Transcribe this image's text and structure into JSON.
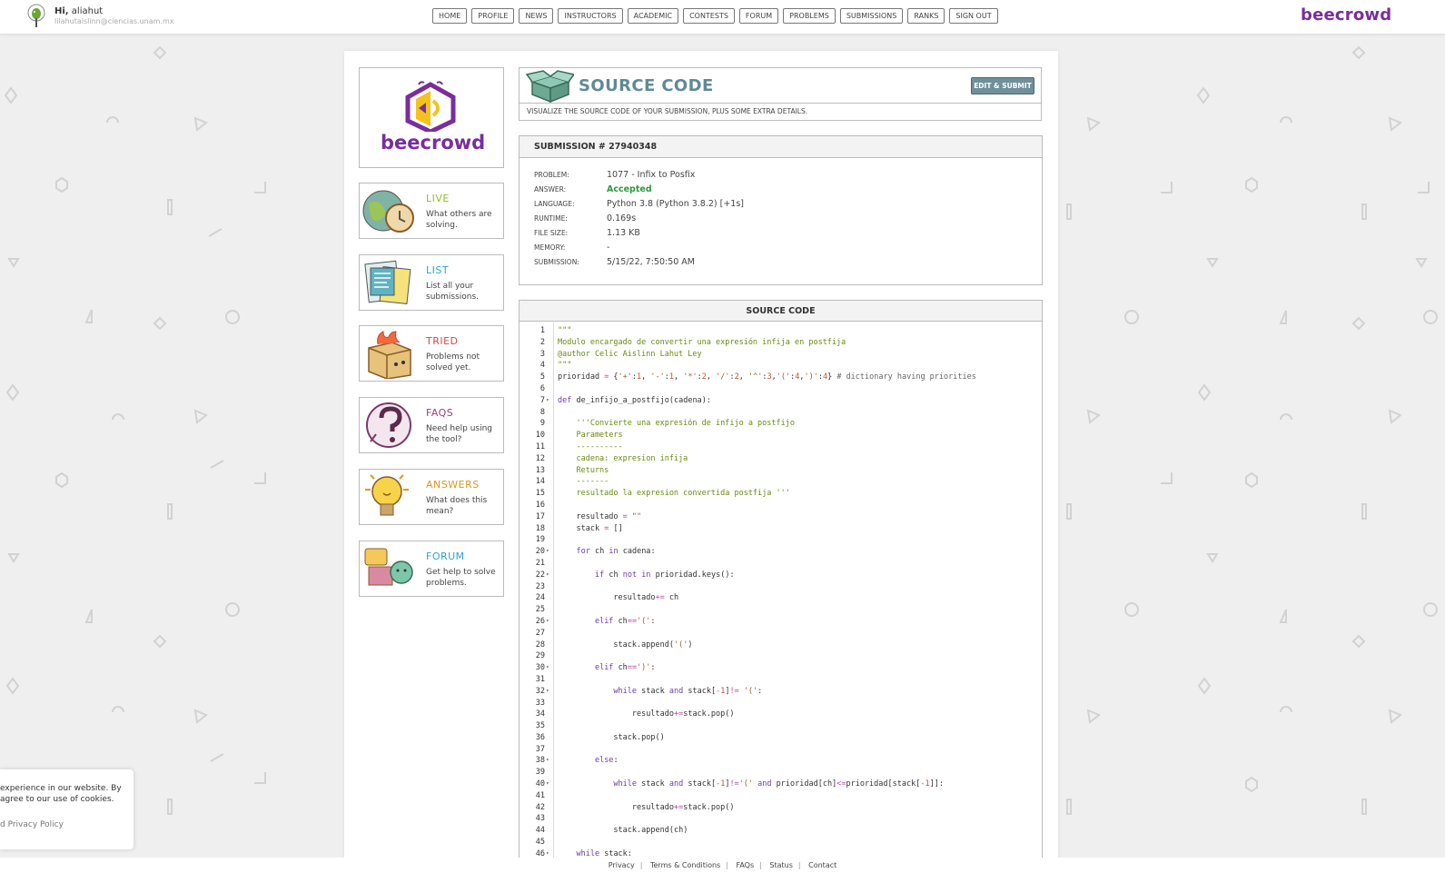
{
  "user": {
    "greeting_prefix": "Hi,",
    "username": "aliahut",
    "email": "lilahutaislinn@ciencias.unam.mx"
  },
  "nav": [
    "HOME",
    "PROFILE",
    "NEWS",
    "INSTRUCTORS",
    "ACADEMIC",
    "CONTESTS",
    "FORUM",
    "PROBLEMS",
    "SUBMISSIONS",
    "RANKS",
    "SIGN OUT"
  ],
  "brand": "beecrowd",
  "logo_text": "beecrowd",
  "sidebar": [
    {
      "title": "LIVE",
      "desc": "What others are solving.",
      "color": "#8bbd2c"
    },
    {
      "title": "LIST",
      "desc": "List all your submissions.",
      "color": "#2ea6c7"
    },
    {
      "title": "TRIED",
      "desc": "Problems not solved yet.",
      "color": "#d24b4b"
    },
    {
      "title": "FAQS",
      "desc": "Need help using the tool?",
      "color": "#a23d7a"
    },
    {
      "title": "ANSWERS",
      "desc": "What does this mean?",
      "color": "#e2961c"
    },
    {
      "title": "FORUM",
      "desc": "Get help to solve problems.",
      "color": "#2ea6c7"
    }
  ],
  "header": {
    "title": "SOURCE CODE",
    "subtitle": "VISUALIZE THE SOURCE CODE OF YOUR SUBMISSION, PLUS SOME EXTRA DETAILS.",
    "edit_button": "EDIT & SUBMIT"
  },
  "submission": {
    "title": "SUBMISSION # 27940348",
    "rows": [
      {
        "k": "PROBLEM:",
        "v": "1077 - Infix to Posfix"
      },
      {
        "k": "ANSWER:",
        "v": "Accepted"
      },
      {
        "k": "LANGUAGE:",
        "v": "Python 3.8 (Python 3.8.2) [+1s]"
      },
      {
        "k": "RUNTIME:",
        "v": "0.169s"
      },
      {
        "k": "FILE SIZE:",
        "v": "1.13 KB"
      },
      {
        "k": "MEMORY:",
        "v": "-"
      },
      {
        "k": "SUBMISSION:",
        "v": "5/15/22, 7:50:50 AM"
      }
    ]
  },
  "code": {
    "title": "SOURCE CODE",
    "lines": [
      "\"\"\"",
      "Modulo encargado de convertir una expresión infija en postfija",
      "@author Celic Aislinn Lahut Ley",
      "\"\"\"",
      "prioridad = {'+':1, '-':1, '*':2, '/':2, '^':3,'(':4,')':4} # dictionary having priorities",
      "",
      "def de_infijo_a_postfijo(cadena):",
      "",
      "    '''Convierte una expresión de infijo a postfijo",
      "    Parameters",
      "    ----------",
      "    cadena: expresion infija",
      "    Returns",
      "    -------",
      "    resultado la expresion convertida postfija '''",
      "",
      "    resultado = \"\"",
      "    stack = []",
      "",
      "    for ch in cadena:",
      "",
      "        if ch not in prioridad.keys():",
      "",
      "            resultado+= ch",
      "",
      "        elif ch=='(':",
      "",
      "            stack.append('(')",
      "",
      "        elif ch==')':",
      "",
      "            while stack and stack[-1]!= '(':",
      "",
      "                resultado+=stack.pop()",
      "",
      "            stack.pop()",
      "",
      "        else:",
      "",
      "            while stack and stack[-1]!='(' and prioridad[ch]<=prioridad[stack[-1]]:",
      "",
      "                resultado+=stack.pop()",
      "",
      "            stack.append(ch)",
      "",
      "    while stack:"
    ],
    "fold_lines": [
      7,
      20,
      22,
      26,
      30,
      32,
      38,
      40,
      46
    ]
  },
  "footer": [
    "Privacy",
    "Terms & Conditions",
    "FAQs",
    "Status",
    "Contact"
  ],
  "cookie": {
    "line1": "experience in our website. By",
    "line2": "agree to our use of cookies.",
    "line3": "d Privacy Policy"
  }
}
